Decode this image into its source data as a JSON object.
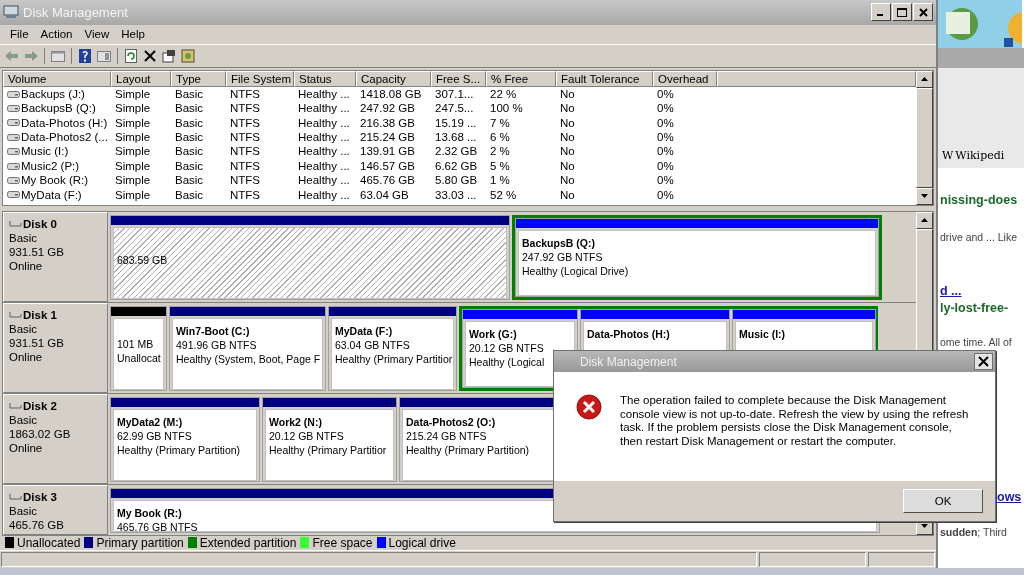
{
  "window": {
    "title": "Disk Management"
  },
  "menu": [
    "File",
    "Action",
    "View",
    "Help"
  ],
  "table": {
    "columns": [
      "Volume",
      "Layout",
      "Type",
      "File System",
      "Status",
      "Capacity",
      "Free S...",
      "% Free",
      "Fault Tolerance",
      "Overhead"
    ],
    "rows": [
      [
        "Backups (J:)",
        "Simple",
        "Basic",
        "NTFS",
        "Healthy ...",
        "1418.08 GB",
        "307.1...",
        "22 %",
        "No",
        "0%"
      ],
      [
        "BackupsB (Q:)",
        "Simple",
        "Basic",
        "NTFS",
        "Healthy ...",
        "247.92 GB",
        "247.5...",
        "100 %",
        "No",
        "0%"
      ],
      [
        "Data-Photos (H:)",
        "Simple",
        "Basic",
        "NTFS",
        "Healthy ...",
        "216.38 GB",
        "15.19 ...",
        "7 %",
        "No",
        "0%"
      ],
      [
        "Data-Photos2 (...",
        "Simple",
        "Basic",
        "NTFS",
        "Healthy ...",
        "215.24 GB",
        "13.68 ...",
        "6 %",
        "No",
        "0%"
      ],
      [
        "Music (I:)",
        "Simple",
        "Basic",
        "NTFS",
        "Healthy ...",
        "139.91 GB",
        "2.32 GB",
        "2 %",
        "No",
        "0%"
      ],
      [
        "Music2 (P:)",
        "Simple",
        "Basic",
        "NTFS",
        "Healthy ...",
        "146.57 GB",
        "6.62 GB",
        "5 %",
        "No",
        "0%"
      ],
      [
        "My Book (R:)",
        "Simple",
        "Basic",
        "NTFS",
        "Healthy ...",
        "465.76 GB",
        "5.80 GB",
        "1 %",
        "No",
        "0%"
      ],
      [
        "MyData (F:)",
        "Simple",
        "Basic",
        "NTFS",
        "Healthy ...",
        "63.04 GB",
        "33.03 ...",
        "52 %",
        "No",
        "0%"
      ]
    ]
  },
  "disks": [
    {
      "name": "Disk 0",
      "type": "Basic",
      "size": "931.51 GB",
      "status": "Online",
      "partitions": [
        {
          "kind": "primary",
          "selected": true,
          "size": "683.59 GB"
        },
        {
          "kind": "extended",
          "selected": false,
          "children": [
            {
              "kind": "logical",
              "selected": false,
              "title": "BackupsB  (Q:)",
              "size": "247.92 GB NTFS",
              "status": "Healthy (Logical Drive)"
            }
          ]
        }
      ]
    },
    {
      "name": "Disk 1",
      "type": "Basic",
      "size": "931.51 GB",
      "status": "Online",
      "partitions": [
        {
          "kind": "unallocated",
          "selected": false,
          "size": "101 MB",
          "status": "Unallocat"
        },
        {
          "kind": "primary",
          "selected": false,
          "title": "Win7-Boot  (C:)",
          "size": "491.96 GB NTFS",
          "status": "Healthy (System, Boot, Page F"
        },
        {
          "kind": "primary",
          "selected": false,
          "title": "MyData  (F:)",
          "size": "63.04 GB NTFS",
          "status": "Healthy (Primary Partitior"
        },
        {
          "kind": "extended",
          "selected": false,
          "children": [
            {
              "kind": "logical",
              "selected": false,
              "title": "Work  (G:)",
              "size": "20.12 GB NTFS",
              "status": "Healthy (Logical"
            },
            {
              "kind": "logical",
              "selected": false,
              "title": "Data-Photos  (H:)"
            },
            {
              "kind": "logical",
              "selected": false,
              "title": "Music  (I:)"
            }
          ]
        }
      ]
    },
    {
      "name": "Disk 2",
      "type": "Basic",
      "size": "1863.02 GB",
      "status": "Online",
      "partitions": [
        {
          "kind": "primary",
          "selected": false,
          "title": "MyData2  (M:)",
          "size": "62.99 GB NTFS",
          "status": "Healthy (Primary Partition)"
        },
        {
          "kind": "primary",
          "selected": false,
          "title": "Work2  (N:)",
          "size": "20.12 GB NTFS",
          "status": "Healthy (Primary Partitior"
        },
        {
          "kind": "primary",
          "selected": false,
          "title": "Data-Photos2  (O:)",
          "size": "215.24 GB NTFS",
          "status": "Healthy (Primary Partition)"
        }
      ]
    },
    {
      "name": "Disk 3",
      "type": "Basic",
      "size": "465.76 GB",
      "partitions": [
        {
          "kind": "primary",
          "selected": false,
          "title": "My Book  (R:)",
          "size": "465.76 GB NTFS"
        }
      ]
    }
  ],
  "legend": [
    {
      "label": "Unallocated",
      "color": "#000000"
    },
    {
      "label": "Primary partition",
      "color": "#000080"
    },
    {
      "label": "Extended partition",
      "color": "#008000"
    },
    {
      "label": "Free space",
      "color": "#33ff33"
    },
    {
      "label": "Logical drive",
      "color": "#0000ff"
    }
  ],
  "dialog": {
    "title": "Disk Management",
    "message": "The operation failed to complete because the Disk Management console view is not up-to-date.  Refresh the view by using the refresh task. If the problem persists close the Disk Management console, then restart Disk Management or restart the computer.",
    "button": "OK"
  },
  "background_page": {
    "tab": {
      "icon": "W",
      "label": "Wikipedi"
    },
    "texts": [
      {
        "kind": "heading",
        "text": "nissing-does"
      },
      {
        "kind": "plain",
        "text": "drive and ... Like"
      },
      {
        "kind": "link",
        "text": "d ..."
      },
      {
        "kind": "heading",
        "text": "ly-lost-free-"
      },
      {
        "kind": "plain",
        "text": "ome time. All of"
      },
      {
        "kind": "link",
        "text": "ows"
      },
      {
        "kind": "plain",
        "text": "**sudden**; Third"
      }
    ]
  }
}
